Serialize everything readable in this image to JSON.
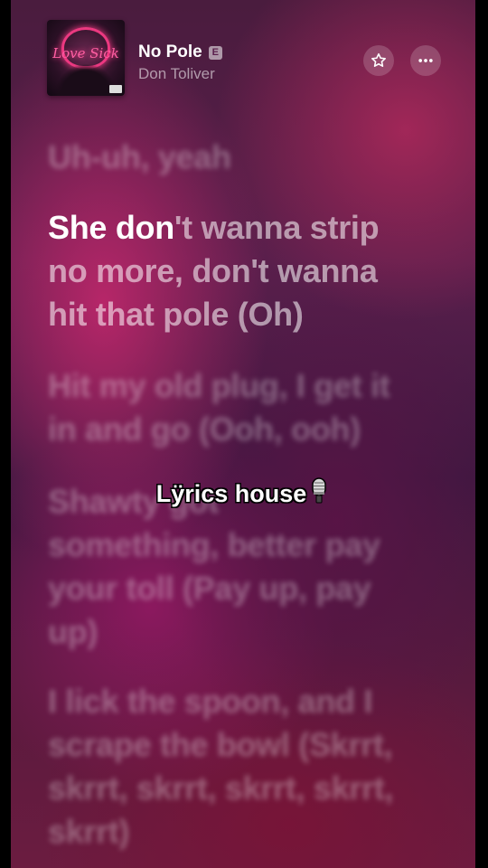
{
  "header": {
    "title": "No Pole",
    "explicit_badge": "E",
    "artist": "Don Toliver",
    "artwork_text": "Love Sick"
  },
  "actions": {
    "favorite_icon": "star-icon",
    "more_icon": "more-icon"
  },
  "lyrics": {
    "previous_line": "Uh-uh, yeah",
    "current_line": {
      "lines": [
        {
          "sung": "She don",
          "unsung": "'t wanna strip"
        },
        {
          "sung": "",
          "unsung": "no more, don't wanna"
        },
        {
          "sung": "",
          "unsung": "hit that pole (Oh)"
        }
      ]
    },
    "upcoming": [
      [
        "Hit my old plug, I get it",
        "in and go (Ooh, ooh)"
      ],
      [
        "Shawty got",
        "something, better pay",
        "your toll (Pay up, pay",
        "up)"
      ],
      [
        "I lick the spoon, and I",
        "scrape the bowl (Skrrt,",
        "skrrt, skrrt, skrrt, skrrt,",
        "skrrt)"
      ]
    ]
  },
  "overlay": {
    "watermark": "Lÿrics house",
    "watermark_icon": "microphone-icon"
  },
  "colors": {
    "background_primary": "#5a1f4c",
    "accent_pink": "#c8286e",
    "text_active": "#ffffff"
  }
}
